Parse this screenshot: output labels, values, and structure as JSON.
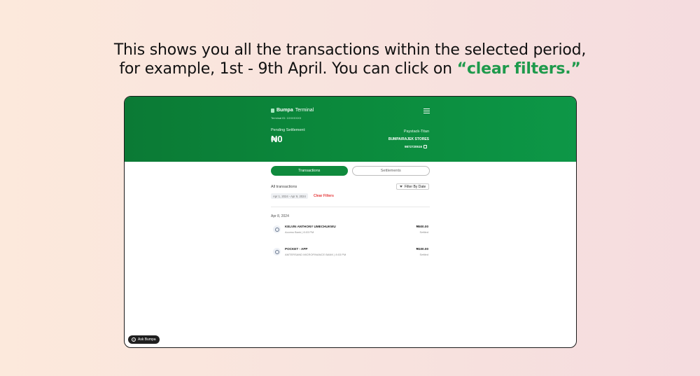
{
  "headline": {
    "line1": "This shows you all the transactions within the selected period,",
    "line2_prefix": "for example, 1st - 9th April. You can click on ",
    "line2_highlight": "“clear filters.”"
  },
  "app": {
    "brand": "Bumpa",
    "brand_suffix": "Terminal",
    "subline": "Terminal ID: 1XXXXXXX",
    "pending_label": "Pending Settlement:",
    "pending_value": "₦0",
    "bank_provider": "Paystack-Titan",
    "store_name": "BUMPA/RAJEK STORES",
    "account_number": "9872720516"
  },
  "tabs": [
    {
      "label": "Transactions",
      "active": true
    },
    {
      "label": "Settlements",
      "active": false
    }
  ],
  "filters": {
    "all_label": "All transactions",
    "filter_button": "Filter By Date",
    "date_range": "Apr 1, 2024 - Apr 9, 2024",
    "clear": "Clear Filters"
  },
  "group_date": "Apr 8, 2024",
  "transactions": [
    {
      "name": "KELVIN ANTHONY UMECHUKWU",
      "meta": "Access Bank | 8:03 PM",
      "amount": "₦500.00",
      "status": "Settled"
    },
    {
      "name": "POCKET - APP",
      "meta": "AMTERSAND MICROFINANCE BANK | 8:03 PM",
      "amount": "₦100.00",
      "status": "Settled"
    }
  ],
  "ask_button": "Ask Bumpa",
  "colors": {
    "brand_green": "#0b8a3c",
    "highlight_green": "#1f9a4c",
    "danger_red": "#e5393a"
  }
}
